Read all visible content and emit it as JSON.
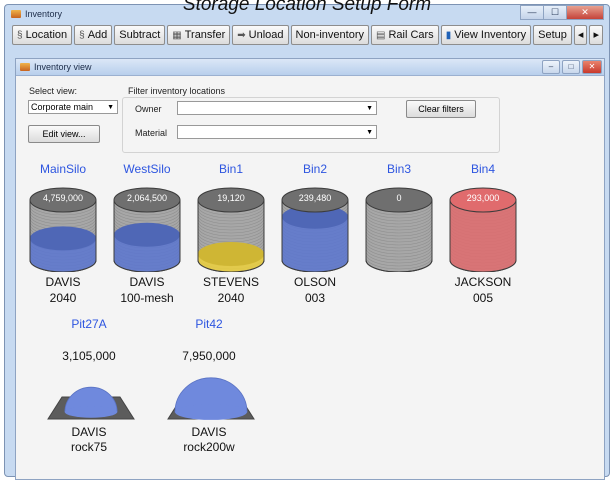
{
  "caption": "Storage Location Setup Form",
  "window": {
    "title": "Inventory",
    "min": "—",
    "max": "☐",
    "close": "✕"
  },
  "toolbar": {
    "location": "Location",
    "add": "Add",
    "subtract": "Subtract",
    "transfer": "Transfer",
    "unload": "Unload",
    "noninventory": "Non-inventory",
    "railcars": "Rail Cars",
    "viewinventory": "View Inventory",
    "setup": "Setup",
    "scroll_left": "◂",
    "scroll_right": "▸"
  },
  "child": {
    "title": "Inventory view",
    "min": "–",
    "max": "□",
    "close": "✕"
  },
  "view": {
    "select_label": "Select view:",
    "selected": "Corporate main",
    "edit_label": "Edit view..."
  },
  "filter": {
    "title": "Filter inventory locations",
    "owner_label": "Owner",
    "owner_value": "",
    "material_label": "Material",
    "material_value": "",
    "clear_label": "Clear filters"
  },
  "tanks": [
    {
      "name": "MainSilo",
      "value": "4,759,000",
      "owner": "DAVIS",
      "material": "2040",
      "fill": 0.36,
      "color": "#5b76d0"
    },
    {
      "name": "WestSilo",
      "value": "2,064,500",
      "owner": "DAVIS",
      "material": "100-mesh",
      "fill": 0.42,
      "color": "#5b76d0"
    },
    {
      "name": "Bin1",
      "value": "19,120",
      "owner": "STEVENS",
      "material": "2040",
      "fill": 0.1,
      "color": "#ecd03c"
    },
    {
      "name": "Bin2",
      "value": "239,480",
      "owner": "OLSON",
      "material": "003",
      "fill": 0.72,
      "color": "#5b76d0"
    },
    {
      "name": "Bin3",
      "value": "0",
      "owner": "",
      "material": "",
      "fill": 0.0,
      "color": "#5b76d0"
    },
    {
      "name": "Bin4",
      "value": "293,000",
      "owner": "JACKSON",
      "material": "005",
      "fill": 1.0,
      "color": "#e06b6d"
    }
  ],
  "pits": [
    {
      "name": "Pit27A",
      "value": "3,105,000",
      "owner": "DAVIS",
      "material": "rock75",
      "size": 0.55,
      "color": "#6f89dd"
    },
    {
      "name": "Pit42",
      "value": "7,950,000",
      "owner": "DAVIS",
      "material": "rock200w",
      "size": 1.0,
      "color": "#6f89dd"
    }
  ]
}
